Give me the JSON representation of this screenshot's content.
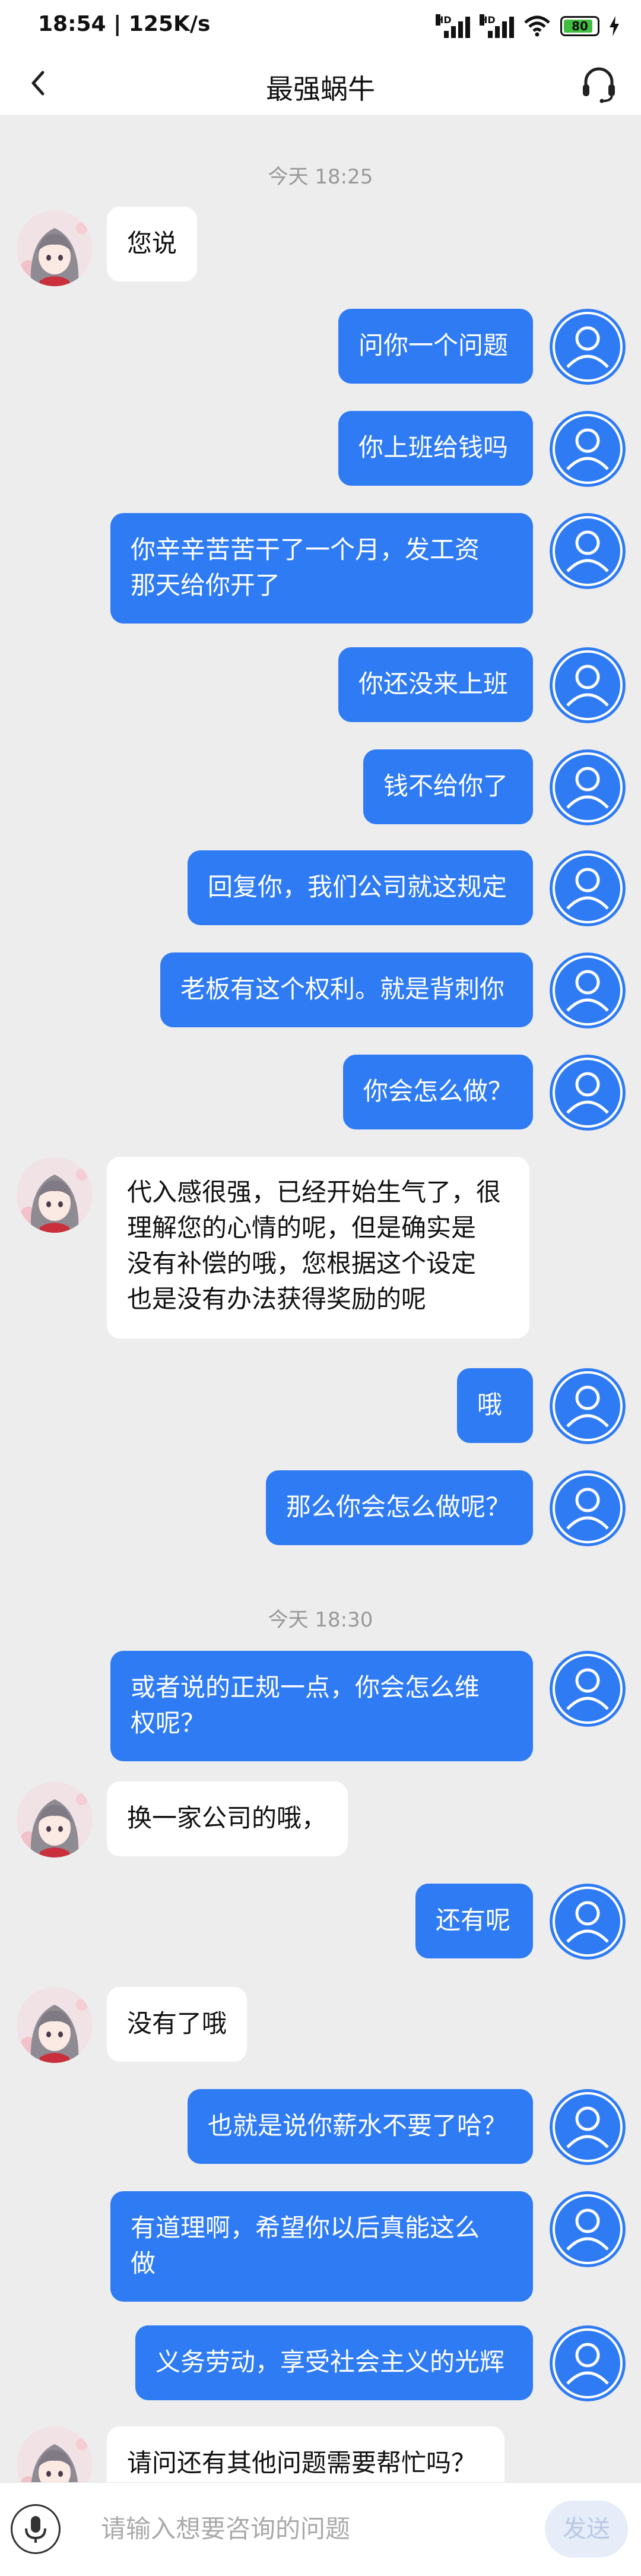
{
  "status_bar": {
    "time_speed": "18:54 | 125K/s",
    "battery": "80"
  },
  "header": {
    "title": "最强蜗牛"
  },
  "timestamps": [
    "今天 18:25",
    "今天 18:30"
  ],
  "messages": [
    {
      "dir": "in",
      "text": "您说"
    },
    {
      "dir": "out",
      "text": "问你一个问题"
    },
    {
      "dir": "out",
      "text": "你上班给钱吗"
    },
    {
      "dir": "out",
      "text": "你辛辛苦苦干了一个月，发工资\n那天给你开了"
    },
    {
      "dir": "out",
      "text": "你还没来上班"
    },
    {
      "dir": "out",
      "text": "钱不给你了"
    },
    {
      "dir": "out",
      "text": "回复你，我们公司就这规定"
    },
    {
      "dir": "out",
      "text": "老板有这个权利。就是背刺你"
    },
    {
      "dir": "out",
      "text": "你会怎么做？"
    },
    {
      "dir": "in",
      "text": "代入感很强，已经开始生气了，很\n理解您的心情的呢，但是确实是\n没有补偿的哦，您根据这个设定\n也是没有办法获得奖励的呢"
    },
    {
      "dir": "out",
      "text": "哦"
    },
    {
      "dir": "out",
      "text": "那么你会怎么做呢？"
    },
    {
      "dir": "out",
      "text": "或者说的正规一点，你会怎么维\n权呢？"
    },
    {
      "dir": "in",
      "text": "换一家公司的哦，"
    },
    {
      "dir": "out",
      "text": "还有呢"
    },
    {
      "dir": "in",
      "text": "没有了哦"
    },
    {
      "dir": "out",
      "text": "也就是说你薪水不要了哈？"
    },
    {
      "dir": "out",
      "text": "有道理啊，希望你以后真能这么\n做"
    },
    {
      "dir": "out",
      "text": "义务劳动，享受社会主义的光辉"
    },
    {
      "dir": "in",
      "text": "请问还有其他问题需要帮忙吗？"
    }
  ],
  "input": {
    "placeholder": "请输入想要咨询的问题"
  },
  "send_label": "发送",
  "colors": {
    "accent": "#2f7bf4",
    "background": "#ededed"
  }
}
